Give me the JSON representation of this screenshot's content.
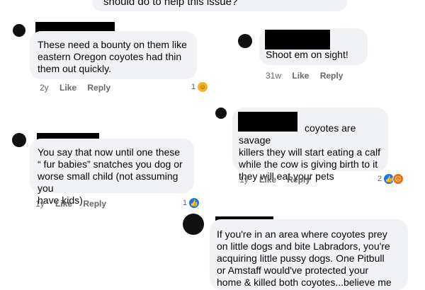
{
  "header": {
    "text": "should do to help this issue?"
  },
  "comments": [
    {
      "text": "These need a bounty on them like\neastern Oregon coyotes had thin\nthem out quickly.",
      "time": "2y",
      "like": "Like",
      "reply": "Reply",
      "reactions": {
        "count": "1",
        "icons": [
          "haha-icon"
        ]
      }
    },
    {
      "text": "Shoot em on sight!",
      "time": "31w",
      "like": "Like",
      "reply": "Reply"
    },
    {
      "text": "coyotes are savage\nkillers they will start eating a calf\nwhile the cow is giving birth to it\nthey will eat your pets",
      "time": "1y",
      "like": "Like",
      "reply": "Reply",
      "reactions": {
        "count": "2",
        "icons": [
          "like-icon",
          "angry-icon"
        ]
      }
    },
    {
      "text": "You say that now until one these\n“ fur babies” snatches you dog or\nworse small child (not assuming you\nhave kids)",
      "time": "1y",
      "like": "Like",
      "reply": "Reply",
      "reactions": {
        "count": "1",
        "icons": [
          "like-icon"
        ]
      }
    },
    {
      "text": "If you're in an area where coyotes prey\non little dogs and bite Labradors, you're\nacquiring little pussy dogs. One Pitbull\nor Amstaff would've protected your\nhome & killed both coyotes...believe me"
    }
  ],
  "colors": {
    "bubble": "#f0f2f5",
    "meta": "#65676b",
    "like_blue": "#1877f2"
  }
}
